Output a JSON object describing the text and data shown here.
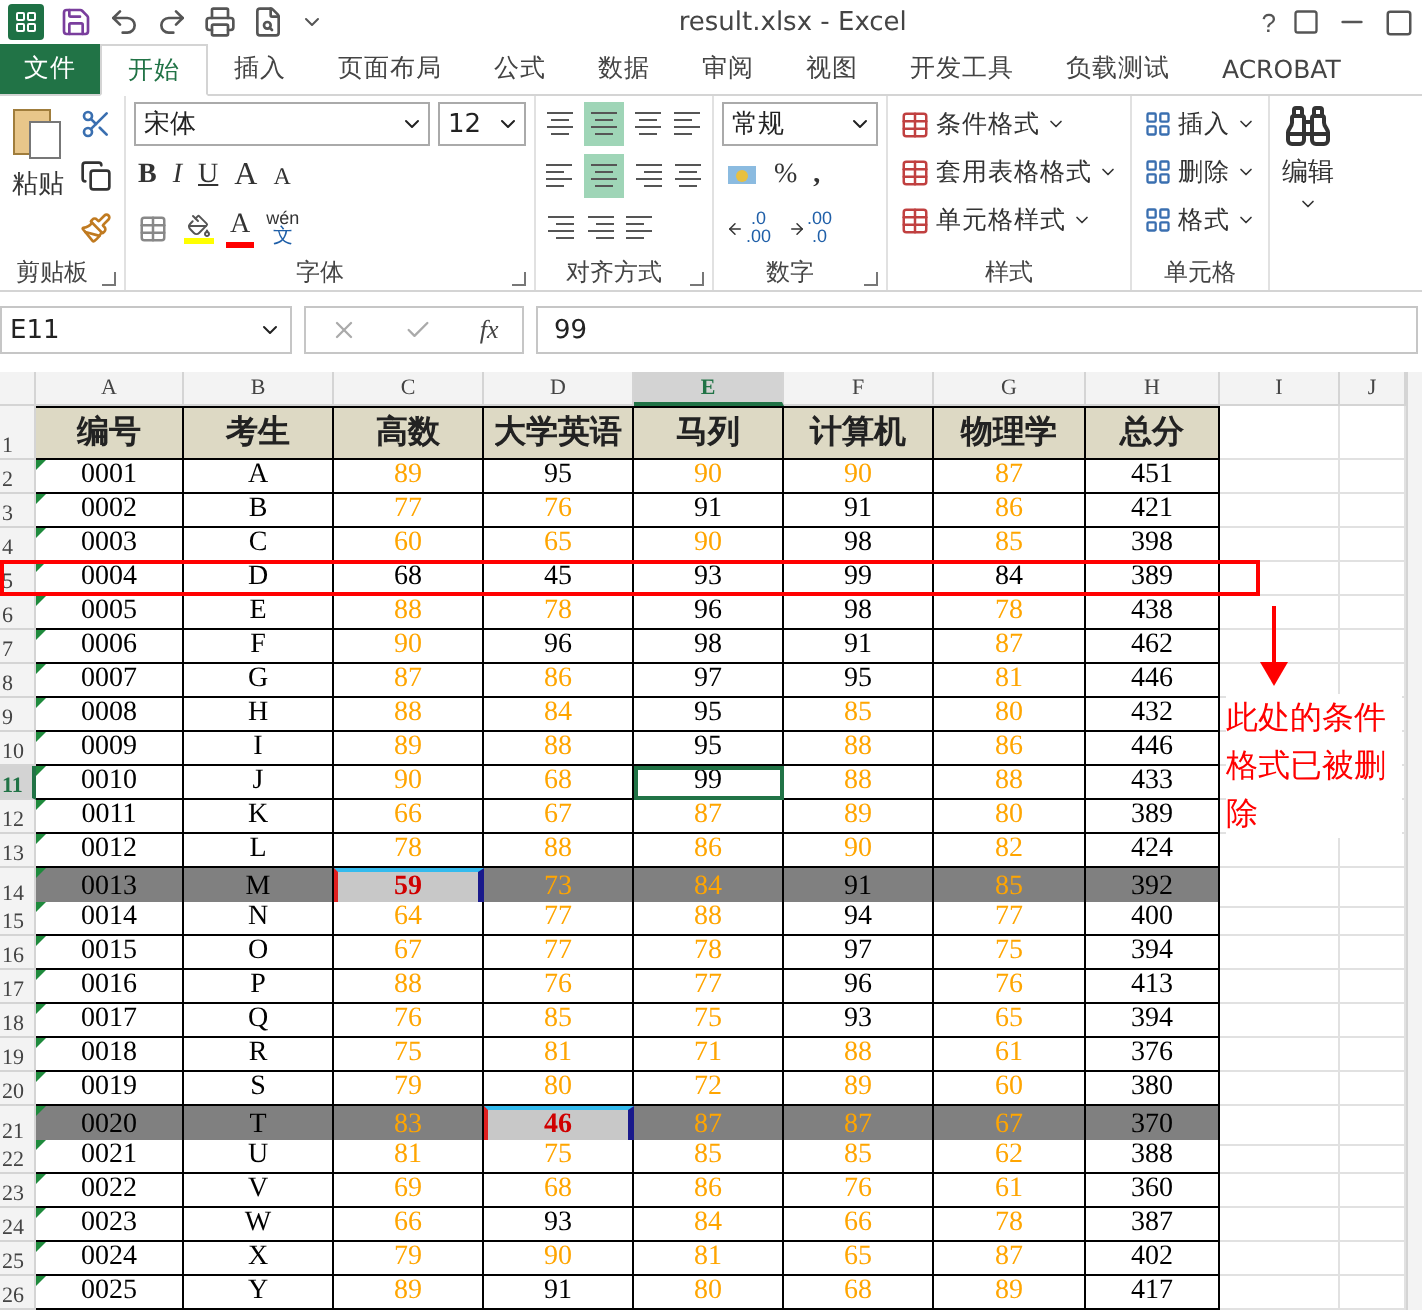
{
  "window": {
    "title": "result.xlsx - Excel",
    "help": "?"
  },
  "tabs": [
    {
      "label": "文件",
      "kind": "file",
      "selected": false
    },
    {
      "label": "开始",
      "kind": "tab",
      "selected": true
    },
    {
      "label": "插入",
      "kind": "tab",
      "selected": false
    },
    {
      "label": "页面布局",
      "kind": "tab",
      "selected": false
    },
    {
      "label": "公式",
      "kind": "tab",
      "selected": false
    },
    {
      "label": "数据",
      "kind": "tab",
      "selected": false
    },
    {
      "label": "审阅",
      "kind": "tab",
      "selected": false
    },
    {
      "label": "视图",
      "kind": "tab",
      "selected": false
    },
    {
      "label": "开发工具",
      "kind": "tab",
      "selected": false
    },
    {
      "label": "负载测试",
      "kind": "tab",
      "selected": false
    },
    {
      "label": "ACROBAT",
      "kind": "tab",
      "selected": false
    }
  ],
  "ribbon": {
    "clipboard": {
      "paste": "粘贴",
      "label": "剪贴板"
    },
    "font": {
      "face": "宋体",
      "size": "12",
      "bold": "B",
      "italic": "I",
      "underline": "U",
      "grow": "A",
      "shrink": "A",
      "font_color_letter": "A",
      "phonetic_top": "wén",
      "phonetic_bottom": "文",
      "label": "字体"
    },
    "alignment": {
      "label": "对齐方式"
    },
    "number": {
      "format": "常规",
      "percent": "%",
      "comma": ",",
      "increase_decimal": [
        ".0",
        ".00"
      ],
      "decrease_decimal": [
        ".00",
        ".0"
      ],
      "label": "数字"
    },
    "styles": {
      "items": [
        "条件格式",
        "套用表格格式",
        "单元格样式"
      ],
      "label": "样式"
    },
    "cells": {
      "items": [
        "插入",
        "删除",
        "格式"
      ],
      "label": "单元格"
    },
    "editing": {
      "label": "编辑"
    }
  },
  "formula_bar": {
    "name_box": "E11",
    "function_label": "fx",
    "content": "99"
  },
  "sheet": {
    "columns": [
      {
        "label": "A",
        "selected": false
      },
      {
        "label": "B",
        "selected": false
      },
      {
        "label": "C",
        "selected": false
      },
      {
        "label": "D",
        "selected": false
      },
      {
        "label": "E",
        "selected": true
      },
      {
        "label": "F",
        "selected": false
      },
      {
        "label": "G",
        "selected": false
      },
      {
        "label": "H",
        "selected": false
      },
      {
        "label": "I",
        "selected": false
      },
      {
        "label": "J",
        "selected": false
      }
    ],
    "header_row": {
      "number": "1",
      "labels": [
        "编号",
        "考生",
        "高数",
        "大学英语",
        "马列",
        "计算机",
        "物理学",
        "总分"
      ]
    },
    "rows": [
      {
        "number": "2",
        "selected": false,
        "shaded": false,
        "boxed": false,
        "id": "0001",
        "name": "A",
        "scores": [
          {
            "text": "89",
            "kind": "warm"
          },
          {
            "text": "95",
            "kind": "plain"
          },
          {
            "text": "90",
            "kind": "warm"
          },
          {
            "text": "90",
            "kind": "warm"
          },
          {
            "text": "87",
            "kind": "warm"
          }
        ],
        "total": "451"
      },
      {
        "number": "3",
        "selected": false,
        "shaded": false,
        "boxed": false,
        "id": "0002",
        "name": "B",
        "scores": [
          {
            "text": "77",
            "kind": "warm"
          },
          {
            "text": "76",
            "kind": "warm"
          },
          {
            "text": "91",
            "kind": "plain"
          },
          {
            "text": "91",
            "kind": "plain"
          },
          {
            "text": "86",
            "kind": "warm"
          }
        ],
        "total": "421"
      },
      {
        "number": "4",
        "selected": false,
        "shaded": false,
        "boxed": false,
        "id": "0003",
        "name": "C",
        "scores": [
          {
            "text": "60",
            "kind": "warm"
          },
          {
            "text": "65",
            "kind": "warm"
          },
          {
            "text": "90",
            "kind": "warm"
          },
          {
            "text": "98",
            "kind": "plain"
          },
          {
            "text": "85",
            "kind": "warm"
          }
        ],
        "total": "398"
      },
      {
        "number": "5",
        "selected": false,
        "shaded": false,
        "boxed": true,
        "id": "0004",
        "name": "D",
        "scores": [
          {
            "text": "68",
            "kind": "plain"
          },
          {
            "text": "45",
            "kind": "plain"
          },
          {
            "text": "93",
            "kind": "plain"
          },
          {
            "text": "99",
            "kind": "plain"
          },
          {
            "text": "84",
            "kind": "plain"
          }
        ],
        "total": "389"
      },
      {
        "number": "6",
        "selected": false,
        "shaded": false,
        "boxed": false,
        "id": "0005",
        "name": "E",
        "scores": [
          {
            "text": "88",
            "kind": "warm"
          },
          {
            "text": "78",
            "kind": "warm"
          },
          {
            "text": "96",
            "kind": "plain"
          },
          {
            "text": "98",
            "kind": "plain"
          },
          {
            "text": "78",
            "kind": "warm"
          }
        ],
        "total": "438"
      },
      {
        "number": "7",
        "selected": false,
        "shaded": false,
        "boxed": false,
        "id": "0006",
        "name": "F",
        "scores": [
          {
            "text": "90",
            "kind": "warm"
          },
          {
            "text": "96",
            "kind": "plain"
          },
          {
            "text": "98",
            "kind": "plain"
          },
          {
            "text": "91",
            "kind": "plain"
          },
          {
            "text": "87",
            "kind": "warm"
          }
        ],
        "total": "462"
      },
      {
        "number": "8",
        "selected": false,
        "shaded": false,
        "boxed": false,
        "id": "0007",
        "name": "G",
        "scores": [
          {
            "text": "87",
            "kind": "warm"
          },
          {
            "text": "86",
            "kind": "warm"
          },
          {
            "text": "97",
            "kind": "plain"
          },
          {
            "text": "95",
            "kind": "plain"
          },
          {
            "text": "81",
            "kind": "warm"
          }
        ],
        "total": "446"
      },
      {
        "number": "9",
        "selected": false,
        "shaded": false,
        "boxed": false,
        "id": "0008",
        "name": "H",
        "scores": [
          {
            "text": "88",
            "kind": "warm"
          },
          {
            "text": "84",
            "kind": "warm"
          },
          {
            "text": "95",
            "kind": "plain"
          },
          {
            "text": "85",
            "kind": "warm"
          },
          {
            "text": "80",
            "kind": "warm"
          }
        ],
        "total": "432"
      },
      {
        "number": "10",
        "selected": false,
        "shaded": false,
        "boxed": false,
        "id": "0009",
        "name": "I",
        "scores": [
          {
            "text": "89",
            "kind": "warm"
          },
          {
            "text": "88",
            "kind": "warm"
          },
          {
            "text": "95",
            "kind": "plain"
          },
          {
            "text": "88",
            "kind": "warm"
          },
          {
            "text": "86",
            "kind": "warm"
          }
        ],
        "total": "446"
      },
      {
        "number": "11",
        "selected": true,
        "shaded": false,
        "boxed": false,
        "id": "0010",
        "name": "J",
        "scores": [
          {
            "text": "90",
            "kind": "warm"
          },
          {
            "text": "68",
            "kind": "warm"
          },
          {
            "text": "99",
            "kind": "plain"
          },
          {
            "text": "88",
            "kind": "warm"
          },
          {
            "text": "88",
            "kind": "warm"
          }
        ],
        "total": "433"
      },
      {
        "number": "12",
        "selected": false,
        "shaded": false,
        "boxed": false,
        "id": "0011",
        "name": "K",
        "scores": [
          {
            "text": "66",
            "kind": "warm"
          },
          {
            "text": "67",
            "kind": "warm"
          },
          {
            "text": "87",
            "kind": "warm"
          },
          {
            "text": "89",
            "kind": "warm"
          },
          {
            "text": "80",
            "kind": "warm"
          }
        ],
        "total": "389"
      },
      {
        "number": "13",
        "selected": false,
        "shaded": false,
        "boxed": false,
        "id": "0012",
        "name": "L",
        "scores": [
          {
            "text": "78",
            "kind": "warm"
          },
          {
            "text": "88",
            "kind": "warm"
          },
          {
            "text": "86",
            "kind": "warm"
          },
          {
            "text": "90",
            "kind": "warm"
          },
          {
            "text": "82",
            "kind": "warm"
          }
        ],
        "total": "424"
      },
      {
        "number": "14",
        "selected": false,
        "shaded": true,
        "boxed": false,
        "id": "0013",
        "name": "M",
        "scores": [
          {
            "text": "59",
            "kind": "fail"
          },
          {
            "text": "73",
            "kind": "warm"
          },
          {
            "text": "84",
            "kind": "warm"
          },
          {
            "text": "91",
            "kind": "plain"
          },
          {
            "text": "85",
            "kind": "warm"
          }
        ],
        "total": "392"
      },
      {
        "number": "15",
        "selected": false,
        "shaded": false,
        "boxed": false,
        "id": "0014",
        "name": "N",
        "scores": [
          {
            "text": "64",
            "kind": "warm"
          },
          {
            "text": "77",
            "kind": "warm"
          },
          {
            "text": "88",
            "kind": "warm"
          },
          {
            "text": "94",
            "kind": "plain"
          },
          {
            "text": "77",
            "kind": "warm"
          }
        ],
        "total": "400"
      },
      {
        "number": "16",
        "selected": false,
        "shaded": false,
        "boxed": false,
        "id": "0015",
        "name": "O",
        "scores": [
          {
            "text": "67",
            "kind": "warm"
          },
          {
            "text": "77",
            "kind": "warm"
          },
          {
            "text": "78",
            "kind": "warm"
          },
          {
            "text": "97",
            "kind": "plain"
          },
          {
            "text": "75",
            "kind": "warm"
          }
        ],
        "total": "394"
      },
      {
        "number": "17",
        "selected": false,
        "shaded": false,
        "boxed": false,
        "id": "0016",
        "name": "P",
        "scores": [
          {
            "text": "88",
            "kind": "warm"
          },
          {
            "text": "76",
            "kind": "warm"
          },
          {
            "text": "77",
            "kind": "warm"
          },
          {
            "text": "96",
            "kind": "plain"
          },
          {
            "text": "76",
            "kind": "warm"
          }
        ],
        "total": "413"
      },
      {
        "number": "18",
        "selected": false,
        "shaded": false,
        "boxed": false,
        "id": "0017",
        "name": "Q",
        "scores": [
          {
            "text": "76",
            "kind": "warm"
          },
          {
            "text": "85",
            "kind": "warm"
          },
          {
            "text": "75",
            "kind": "warm"
          },
          {
            "text": "93",
            "kind": "plain"
          },
          {
            "text": "65",
            "kind": "warm"
          }
        ],
        "total": "394"
      },
      {
        "number": "19",
        "selected": false,
        "shaded": false,
        "boxed": false,
        "id": "0018",
        "name": "R",
        "scores": [
          {
            "text": "75",
            "kind": "warm"
          },
          {
            "text": "81",
            "kind": "warm"
          },
          {
            "text": "71",
            "kind": "warm"
          },
          {
            "text": "88",
            "kind": "warm"
          },
          {
            "text": "61",
            "kind": "warm"
          }
        ],
        "total": "376"
      },
      {
        "number": "20",
        "selected": false,
        "shaded": false,
        "boxed": false,
        "id": "0019",
        "name": "S",
        "scores": [
          {
            "text": "79",
            "kind": "warm"
          },
          {
            "text": "80",
            "kind": "warm"
          },
          {
            "text": "72",
            "kind": "warm"
          },
          {
            "text": "89",
            "kind": "warm"
          },
          {
            "text": "60",
            "kind": "warm"
          }
        ],
        "total": "380"
      },
      {
        "number": "21",
        "selected": false,
        "shaded": true,
        "boxed": false,
        "id": "0020",
        "name": "T",
        "scores": [
          {
            "text": "83",
            "kind": "warm"
          },
          {
            "text": "46",
            "kind": "fail"
          },
          {
            "text": "87",
            "kind": "warm"
          },
          {
            "text": "87",
            "kind": "warm"
          },
          {
            "text": "67",
            "kind": "warm"
          }
        ],
        "total": "370"
      },
      {
        "number": "22",
        "selected": false,
        "shaded": false,
        "boxed": false,
        "id": "0021",
        "name": "U",
        "scores": [
          {
            "text": "81",
            "kind": "warm"
          },
          {
            "text": "75",
            "kind": "warm"
          },
          {
            "text": "85",
            "kind": "warm"
          },
          {
            "text": "85",
            "kind": "warm"
          },
          {
            "text": "62",
            "kind": "warm"
          }
        ],
        "total": "388"
      },
      {
        "number": "23",
        "selected": false,
        "shaded": false,
        "boxed": false,
        "id": "0022",
        "name": "V",
        "scores": [
          {
            "text": "69",
            "kind": "warm"
          },
          {
            "text": "68",
            "kind": "warm"
          },
          {
            "text": "86",
            "kind": "warm"
          },
          {
            "text": "76",
            "kind": "warm"
          },
          {
            "text": "61",
            "kind": "warm"
          }
        ],
        "total": "360"
      },
      {
        "number": "24",
        "selected": false,
        "shaded": false,
        "boxed": false,
        "id": "0023",
        "name": "W",
        "scores": [
          {
            "text": "66",
            "kind": "warm"
          },
          {
            "text": "93",
            "kind": "plain"
          },
          {
            "text": "84",
            "kind": "warm"
          },
          {
            "text": "66",
            "kind": "warm"
          },
          {
            "text": "78",
            "kind": "warm"
          }
        ],
        "total": "387"
      },
      {
        "number": "25",
        "selected": false,
        "shaded": false,
        "boxed": false,
        "id": "0024",
        "name": "X",
        "scores": [
          {
            "text": "79",
            "kind": "warm"
          },
          {
            "text": "90",
            "kind": "warm"
          },
          {
            "text": "81",
            "kind": "warm"
          },
          {
            "text": "65",
            "kind": "warm"
          },
          {
            "text": "87",
            "kind": "warm"
          }
        ],
        "total": "402"
      },
      {
        "number": "26",
        "selected": false,
        "shaded": false,
        "boxed": false,
        "id": "0025",
        "name": "Y",
        "scores": [
          {
            "text": "89",
            "kind": "warm"
          },
          {
            "text": "91",
            "kind": "plain"
          },
          {
            "text": "80",
            "kind": "warm"
          },
          {
            "text": "68",
            "kind": "warm"
          },
          {
            "text": "89",
            "kind": "warm"
          }
        ],
        "total": "417"
      }
    ]
  },
  "annotation": {
    "note": "此处的条件格式已被删除"
  }
}
